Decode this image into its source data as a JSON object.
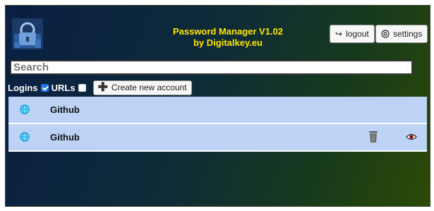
{
  "header": {
    "title_line1": "Password Manager V1.02",
    "title_line2": "by Digitalkey.eu",
    "logout_label": "logout",
    "settings_label": "settings"
  },
  "search": {
    "placeholder": "Search",
    "value": ""
  },
  "filters": {
    "logins_label": "Logins",
    "logins_checked": true,
    "urls_label": "URLs",
    "urls_checked": false,
    "create_label": "Create new account"
  },
  "accounts": [
    {
      "name": "Github"
    },
    {
      "name": "Github"
    }
  ],
  "colors": {
    "title": "#ffe600",
    "row_bg": "#bcd3f5",
    "globe": "#17a2d8"
  },
  "icons": [
    "app-logo",
    "logout-icon",
    "settings-icon",
    "plus-icon",
    "globe-icon",
    "trash-icon",
    "eye-icon"
  ]
}
